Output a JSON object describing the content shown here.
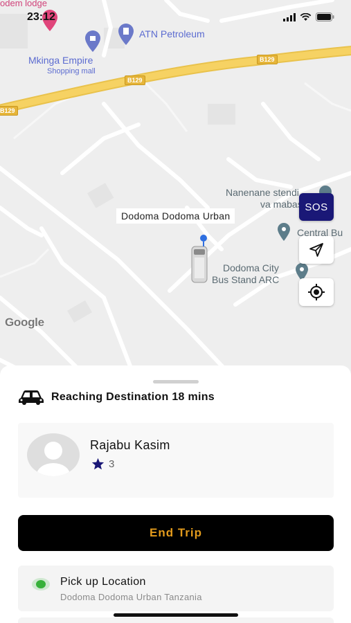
{
  "status_bar": {
    "time": "23:12"
  },
  "map": {
    "labels": {
      "lodge": "odem lodge",
      "atn": "ATN Petroleum",
      "mkinga": "Mkinga Empire",
      "mkinga_sub": "Shopping mall",
      "nanenane_1": "Nanenane stendi",
      "nanenane_2": "va mabasi",
      "central": "Central Bu",
      "bus_stand_1": "Dodoma City",
      "bus_stand_2": "Bus Stand ARC"
    },
    "road_shields": [
      "B129",
      "B129",
      "B129"
    ],
    "place_chip": "Dodoma Dodoma Urban",
    "attribution": "Google",
    "sos_label": "SOS"
  },
  "sheet": {
    "eta_text": "Reaching Destination 18 mins",
    "driver": {
      "name": "Rajabu Kasim",
      "rating": "3"
    },
    "end_trip_label": "End Trip",
    "pickup": {
      "title": "Pick up Location",
      "address": "Dodoma Dodoma Urban Tanzania"
    }
  },
  "colors": {
    "sos": "#1a1877",
    "end_trip_bg": "#000000",
    "end_trip_text": "#e39b1c",
    "road": "#f1c44a",
    "pickup_dot": "#37b13a"
  }
}
